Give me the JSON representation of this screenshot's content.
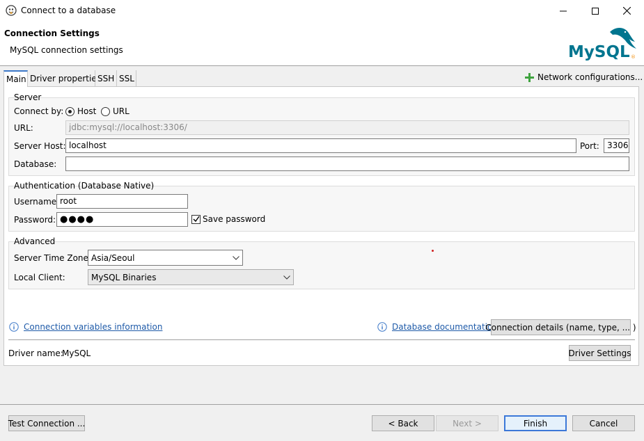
{
  "window": {
    "title": "Connect to a database",
    "icon": "dbeaver-beaver-icon"
  },
  "header": {
    "title": "Connection Settings",
    "subtitle": "MySQL connection settings",
    "logo_text": "MySQL",
    "logo_color": "#00758F",
    "logo_accent": "#F29111"
  },
  "tabs": [
    {
      "label": "Main",
      "active": true
    },
    {
      "label": "Driver properties"
    },
    {
      "label": "SSH"
    },
    {
      "label": "SSL"
    }
  ],
  "network_configurations": {
    "label": "Network configurations...",
    "icon": "plus-icon",
    "color": "#3fa33f"
  },
  "server": {
    "group_label": "Server",
    "connect_by_label": "Connect by:",
    "connect_by_options": [
      {
        "label": "Host",
        "selected": true
      },
      {
        "label": "URL",
        "selected": false
      }
    ],
    "url_label": "URL:",
    "url_value": "jdbc:mysql://localhost:3306/",
    "host_label": "Server Host:",
    "host_value": "localhost",
    "port_label": "Port:",
    "port_value": "3306",
    "database_label": "Database:",
    "database_value": ""
  },
  "auth": {
    "group_label": "Authentication (Database Native)",
    "username_label": "Username:",
    "username_value": "root",
    "password_label": "Password:",
    "password_value": "●●●●",
    "save_password_label": "Save password",
    "save_password_checked": true
  },
  "advanced": {
    "group_label": "Advanced",
    "timezone_label": "Server Time Zone:",
    "timezone_value": "Asia/Seoul",
    "client_label": "Local Client:",
    "client_value": "MySQL Binaries"
  },
  "links": {
    "variables": "Connection variables information",
    "docs": "Database documentation",
    "details_button": "Connection details (name, type, ... )"
  },
  "driver": {
    "label": "Driver name:",
    "value": "MySQL",
    "settings_button": "Driver Settings"
  },
  "footer": {
    "test": "Test Connection ...",
    "back": "< Back",
    "next": "Next >",
    "finish": "Finish",
    "cancel": "Cancel"
  }
}
